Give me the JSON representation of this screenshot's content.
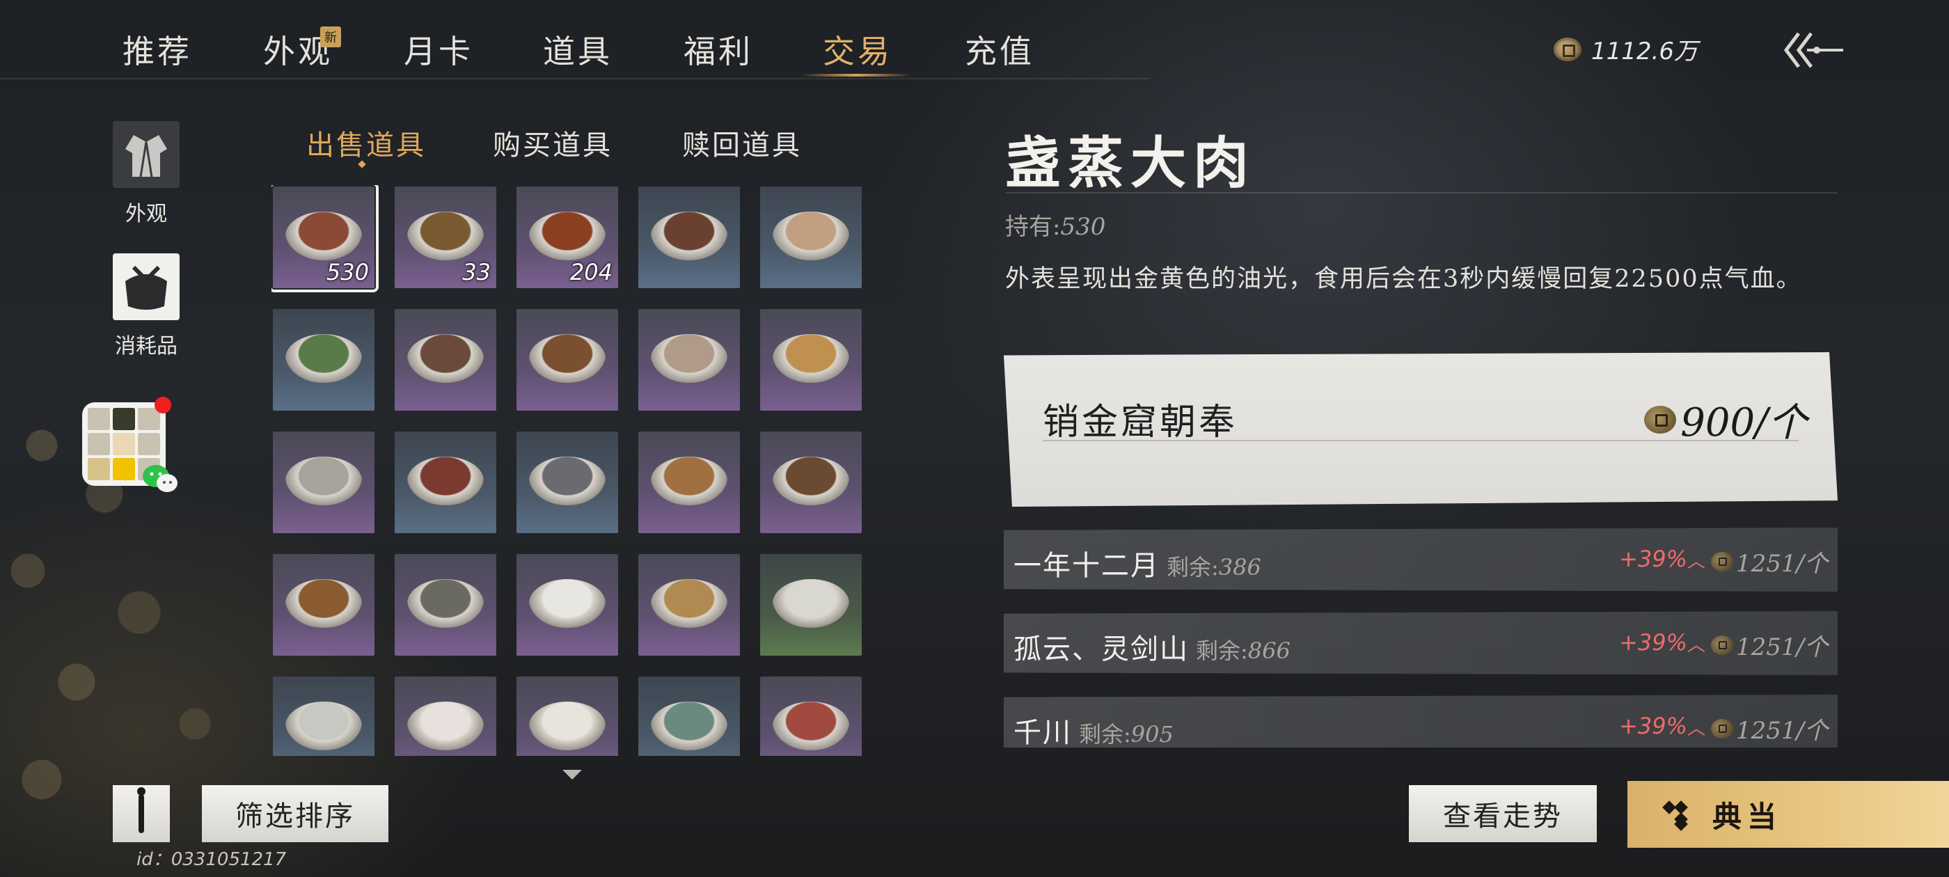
{
  "nav": {
    "tabs": [
      {
        "label": "推荐"
      },
      {
        "label": "外观",
        "badge": "新"
      },
      {
        "label": "月卡"
      },
      {
        "label": "道具"
      },
      {
        "label": "福利"
      },
      {
        "label": "交易",
        "active": true
      },
      {
        "label": "充值"
      }
    ],
    "currency": "1112.6万",
    "back_icon": "double-chevron-left-icon"
  },
  "sidebar": {
    "items": [
      {
        "label": "外观",
        "icon": "robe-icon"
      },
      {
        "label": "消耗品",
        "icon": "consumable-bag-icon"
      }
    ],
    "floating_app_icon": "wechat-icon"
  },
  "subtabs": [
    {
      "label": "出售道具",
      "active": true
    },
    {
      "label": "购买道具"
    },
    {
      "label": "赎回道具"
    }
  ],
  "inventory": {
    "items": [
      {
        "count": "530",
        "bg": "purple",
        "food": "#8a4a36",
        "selected": true
      },
      {
        "count": "33",
        "bg": "purple",
        "food": "#7a5a30"
      },
      {
        "count": "204",
        "bg": "purple",
        "food": "#8a4020"
      },
      {
        "count": "",
        "bg": "blue",
        "food": "#6a4030"
      },
      {
        "count": "",
        "bg": "blue",
        "food": "#c0a080"
      },
      {
        "count": "",
        "bg": "blue",
        "food": "#5a7a4a"
      },
      {
        "count": "",
        "bg": "purple",
        "food": "#6a4a3a"
      },
      {
        "count": "",
        "bg": "purple",
        "food": "#7a5030"
      },
      {
        "count": "",
        "bg": "purple",
        "food": "#b09a88"
      },
      {
        "count": "",
        "bg": "purple",
        "food": "#c09050"
      },
      {
        "count": "",
        "bg": "purple",
        "food": "#a8a49c"
      },
      {
        "count": "",
        "bg": "blue",
        "food": "#7a3a30"
      },
      {
        "count": "",
        "bg": "blue",
        "food": "#6a6a70"
      },
      {
        "count": "",
        "bg": "purple",
        "food": "#a07040"
      },
      {
        "count": "",
        "bg": "purple",
        "food": "#6a4a30"
      },
      {
        "count": "",
        "bg": "purple",
        "food": "#8a5a30"
      },
      {
        "count": "",
        "bg": "purple",
        "food": "#6a6a60"
      },
      {
        "count": "",
        "bg": "purple",
        "food": "#e8e6e0"
      },
      {
        "count": "",
        "bg": "purple",
        "food": "#b08a50"
      },
      {
        "count": "",
        "bg": "green",
        "food": "#d8d8d0"
      },
      {
        "count": "",
        "bg": "blue",
        "food": "#c8c8c2"
      },
      {
        "count": "",
        "bg": "purple",
        "food": "#e8e0dc"
      },
      {
        "count": "",
        "bg": "purple",
        "food": "#e8e4dc"
      },
      {
        "count": "",
        "bg": "blue",
        "food": "#6a8a80"
      },
      {
        "count": "",
        "bg": "purple",
        "food": "#a04a40"
      }
    ]
  },
  "detail": {
    "title": "盏蒸大肉",
    "owned_label": "持有:",
    "owned_value": "530",
    "description": "外表呈现出金黄色的油光，食用后会在3秒内缓慢回复22500点气血。",
    "best": {
      "server": "销金窟朝奉",
      "price": "900/个"
    },
    "listings": [
      {
        "server": "一年十二月",
        "remain_label": "剩余:",
        "remain": "386",
        "pct": "+39%",
        "price": "1251/个"
      },
      {
        "server": "孤云、灵剑山",
        "remain_label": "剩余:",
        "remain": "866",
        "pct": "+39%",
        "price": "1251/个"
      },
      {
        "server": "千川",
        "remain_label": "剩余:",
        "remain": "905",
        "pct": "+39%",
        "price": "1251/个"
      }
    ]
  },
  "footer": {
    "filter_label": "筛选排序",
    "uid": "id：0331051217",
    "trend_label": "查看走势",
    "pawn_label": "典当"
  },
  "colors": {
    "accent": "#e0a85a",
    "rise": "#ef6b6b",
    "pawn_button": "#e8c47e"
  }
}
